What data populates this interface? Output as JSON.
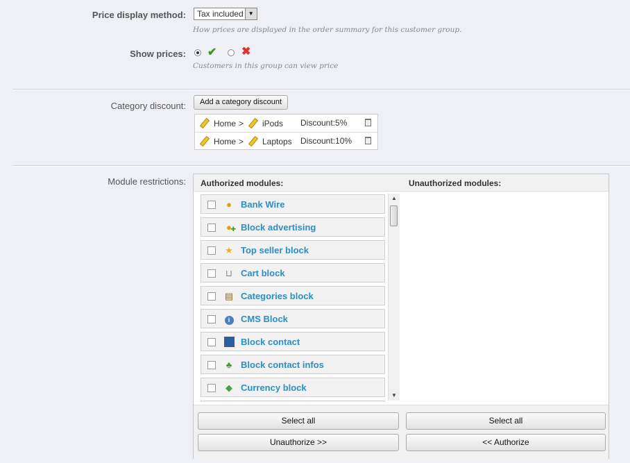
{
  "price_display": {
    "label": "Price display method:",
    "value": "Tax included",
    "hint": "How prices are displayed in the order summary for this customer group."
  },
  "show_prices": {
    "label": "Show prices:",
    "hint": "Customers in this group can view price",
    "yes_icon": "check-icon",
    "no_icon": "cross-icon"
  },
  "category_discount": {
    "label": "Category discount:",
    "add_button": "Add a category discount",
    "rows": [
      {
        "home": "Home",
        "sep": ">",
        "category": "iPods",
        "discount": "Discount:5%"
      },
      {
        "home": "Home",
        "sep": ">",
        "category": "Laptops",
        "discount": "Discount:10%"
      }
    ]
  },
  "modules": {
    "label": "Module restrictions:",
    "authorized_header": "Authorized modules:",
    "unauthorized_header": "Unauthorized modules:",
    "items": [
      {
        "name": "Bank Wire",
        "icon": "coins-icon"
      },
      {
        "name": "Block advertising",
        "icon": "coins-add-icon"
      },
      {
        "name": "Top seller block",
        "icon": "award-star-icon"
      },
      {
        "name": "Cart block",
        "icon": "basket-icon"
      },
      {
        "name": "Categories block",
        "icon": "notebook-icon"
      },
      {
        "name": "CMS Block",
        "icon": "info-icon"
      },
      {
        "name": "Block contact",
        "icon": "blue-square-icon"
      },
      {
        "name": "Block contact infos",
        "icon": "contact-card-icon"
      },
      {
        "name": "Currency block",
        "icon": "money-icon"
      }
    ],
    "select_all_left": "Select all",
    "select_all_right": "Select all",
    "unauthorize_button": "Unauthorize >>",
    "authorize_button": "<< Authorize"
  },
  "colors": {
    "background": "#eef0f6",
    "module_link": "#2a8ec8",
    "check": "#3a9a1f",
    "cross": "#e0332a"
  }
}
